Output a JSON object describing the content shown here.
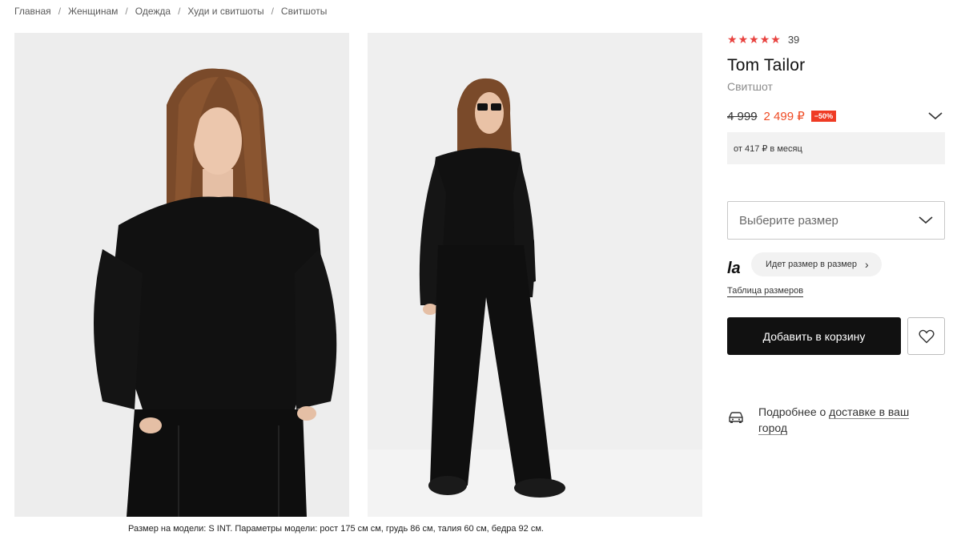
{
  "breadcrumb": [
    "Главная",
    "Женщинам",
    "Одежда",
    "Худи и свитшоты",
    "Свитшоты"
  ],
  "breadcrumb_separator": "/",
  "product": {
    "rating_count": "39",
    "rating_stars": 5,
    "brand": "Tom Tailor",
    "category": "Свитшот",
    "old_price": "4 999",
    "new_price": "2 499 ₽",
    "discount": "−50%",
    "installment": "от 417 ₽ в месяц"
  },
  "size": {
    "placeholder": "Выберите размер",
    "fit_logo": "la",
    "fit_label": "Идет размер в размер",
    "size_table_label": "Таблица размеров"
  },
  "actions": {
    "add_to_cart": "Добавить в корзину"
  },
  "delivery": {
    "text_prefix": "Подробнее о ",
    "link_text": "доставке в ваш город"
  },
  "model_caption": "Размер на модели: S INT. Параметры модели: рост 175 см см, грудь 86 см, талия 60 см, бедра 92 см.",
  "colors": {
    "accent_price": "#ef4b24",
    "star": "#e8423f",
    "badge": "#ef3b24",
    "button": "#111111"
  },
  "icons": {
    "star": "star-icon",
    "chevron": "chevron-down-icon",
    "heart": "heart-icon",
    "delivery": "car-icon"
  }
}
